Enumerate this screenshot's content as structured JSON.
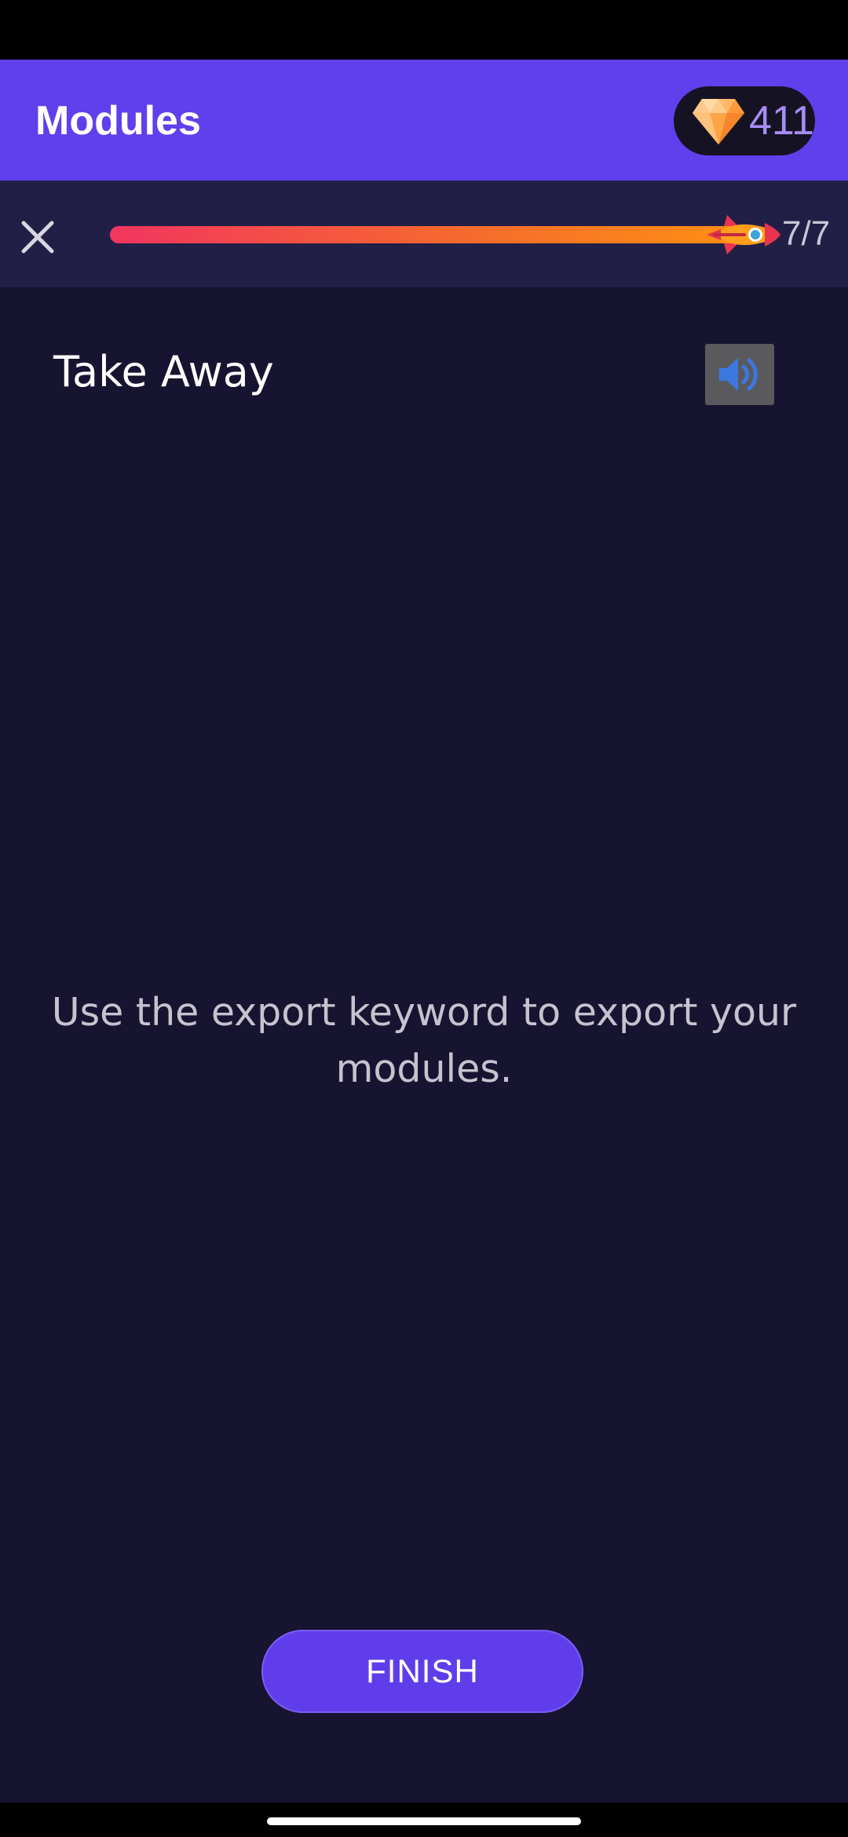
{
  "app_bar": {
    "title": "Modules",
    "gems": {
      "icon": "diamond-icon",
      "count": "411"
    }
  },
  "progress": {
    "close_icon": "close-icon",
    "current": 7,
    "total": 7,
    "label": "7/7",
    "fraction": 1.0,
    "rocket_icon": "rocket-icon"
  },
  "lesson": {
    "title": "Take Away",
    "audio_icon": "speaker-icon",
    "text": "Use the export keyword to export your modules.",
    "finish_label": "FINISH"
  },
  "colors": {
    "app_bar": "#6040EC",
    "background": "#161430",
    "progress_start": "#F2355F",
    "progress_end": "#FF9112",
    "button": "#5F3DEA",
    "gem_count": "#A78CF5"
  }
}
